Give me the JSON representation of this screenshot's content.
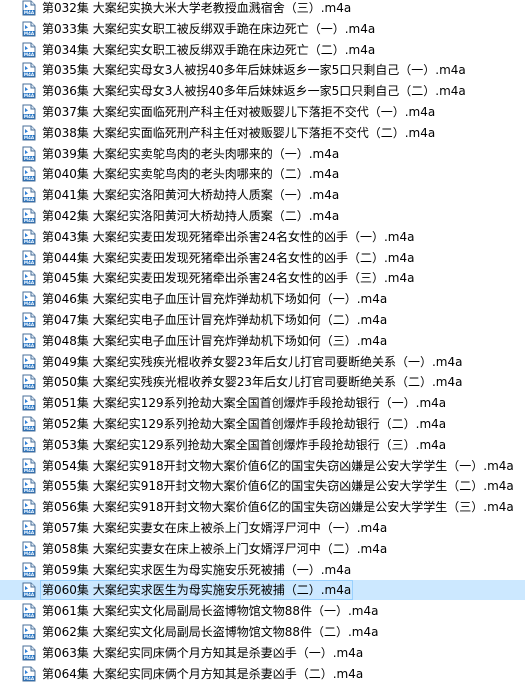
{
  "files": [
    {
      "name": "第032集 大案纪实换大米大学老教授血溅宿舍（三）.m4a"
    },
    {
      "name": "第033集 大案纪实女职工被反绑双手跪在床边死亡（一）.m4a"
    },
    {
      "name": "第034集 大案纪实女职工被反绑双手跪在床边死亡（二）.m4a"
    },
    {
      "name": "第035集 大案纪实母女3人被拐40多年后妹妹返乡一家5口只剩自己（一）.m4a"
    },
    {
      "name": "第036集 大案纪实母女3人被拐40多年后妹妹返乡一家5口只剩自己（二）.m4a"
    },
    {
      "name": "第037集 大案纪实面临死刑产科主任对被贩婴儿下落拒不交代（一）.m4a"
    },
    {
      "name": "第038集 大案纪实面临死刑产科主任对被贩婴儿下落拒不交代（二）.m4a"
    },
    {
      "name": "第039集 大案纪实卖鸵鸟肉的老头肉哪来的（一）.m4a"
    },
    {
      "name": "第040集 大案纪实卖鸵鸟肉的老头肉哪来的（二）.m4a"
    },
    {
      "name": "第041集 大案纪实洛阳黄河大桥劫持人质案（一）.m4a"
    },
    {
      "name": "第042集 大案纪实洛阳黄河大桥劫持人质案（二）.m4a"
    },
    {
      "name": "第043集 大案纪实麦田发现死猪牵出杀害24名女性的凶手（一）.m4a"
    },
    {
      "name": "第044集 大案纪实麦田发现死猪牵出杀害24名女性的凶手（二）.m4a"
    },
    {
      "name": "第045集 大案纪实麦田发现死猪牵出杀害24名女性的凶手（三）.m4a"
    },
    {
      "name": "第046集 大案纪实电子血压计冒充炸弹劫机下场如何（一）.m4a"
    },
    {
      "name": "第047集 大案纪实电子血压计冒充炸弹劫机下场如何（二）.m4a"
    },
    {
      "name": "第048集 大案纪实电子血压计冒充炸弹劫机下场如何（三）.m4a"
    },
    {
      "name": "第049集 大案纪实残疾光棍收养女婴23年后女儿打官司要断绝关系（一）.m4a"
    },
    {
      "name": "第050集 大案纪实残疾光棍收养女婴23年后女儿打官司要断绝关系（二）.m4a"
    },
    {
      "name": "第051集 大案纪实129系列抢劫大案全国首创爆炸手段抢劫银行（一）.m4a"
    },
    {
      "name": "第052集 大案纪实129系列抢劫大案全国首创爆炸手段抢劫银行（二）.m4a"
    },
    {
      "name": "第053集 大案纪实129系列抢劫大案全国首创爆炸手段抢劫银行（三）.m4a"
    },
    {
      "name": "第054集 大案纪实918开封文物大案价值6亿的国宝失窃凶嫌是公安大学学生（一）.m4a"
    },
    {
      "name": "第055集 大案纪实918开封文物大案价值6亿的国宝失窃凶嫌是公安大学学生（二）.m4a"
    },
    {
      "name": "第056集 大案纪实918开封文物大案价值6亿的国宝失窃凶嫌是公安大学学生（三）.m4a"
    },
    {
      "name": "第057集 大案纪实妻女在床上被杀上门女婿浮尸河中（一）.m4a"
    },
    {
      "name": "第058集 大案纪实妻女在床上被杀上门女婿浮尸河中（二）.m4a"
    },
    {
      "name": "第059集 大案纪实求医生为母实施安乐死被捕（一）.m4a"
    },
    {
      "name": "第060集 大案纪实求医生为母实施安乐死被捕（二）.m4a",
      "selected": true
    },
    {
      "name": "第061集 大案纪实文化局副局长盗博物馆文物88件（一）.m4a"
    },
    {
      "name": "第062集 大案纪实文化局副局长盗博物馆文物88件（二）.m4a"
    },
    {
      "name": "第063集 大案纪实同床俩个月方知其是杀妻凶手（一）.m4a"
    },
    {
      "name": "第064集 大案纪实同床俩个月方知其是杀妻凶手（二）.m4a"
    }
  ],
  "icons": {
    "file_type": "m4a-audio-file-icon"
  },
  "colors": {
    "selection": "#cce8ff",
    "selection_border": "#99d1ff",
    "icon_accent": "#1a6fc4"
  }
}
